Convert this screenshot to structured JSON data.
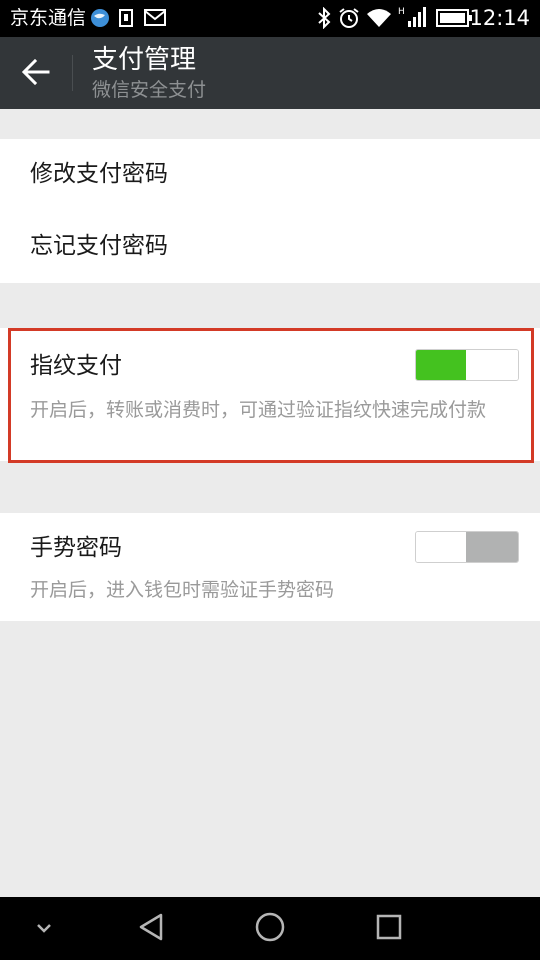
{
  "status_bar": {
    "carrier": "京东通信",
    "time": "12:14",
    "icons": [
      "globe-icon",
      "sim-icon",
      "mail-icon",
      "bluetooth-icon",
      "alarm-icon",
      "wifi-icon",
      "signal-icon",
      "battery-icon"
    ]
  },
  "app_bar": {
    "title": "支付管理",
    "subtitle": "微信安全支付",
    "back_icon": "arrow-left-icon"
  },
  "password_section": {
    "items": [
      {
        "label": "修改支付密码"
      },
      {
        "label": "忘记支付密码"
      }
    ]
  },
  "fingerprint": {
    "label": "指纹支付",
    "description": "开启后，转账或消费时，可通过验证指纹快速完成付款",
    "enabled": true
  },
  "gesture": {
    "label": "手势密码",
    "description": "开启后，进入钱包时需验证手势密码",
    "enabled": false
  },
  "colors": {
    "app_bar": "#323639",
    "switch_on": "#44c21f",
    "switch_off": "#b1b2b2",
    "highlight": "#d33a26",
    "background": "#ebebeb"
  },
  "nav_bar": {
    "icons": [
      "chevron-down-icon",
      "back-triangle-icon",
      "home-circle-icon",
      "recents-square-icon"
    ]
  }
}
